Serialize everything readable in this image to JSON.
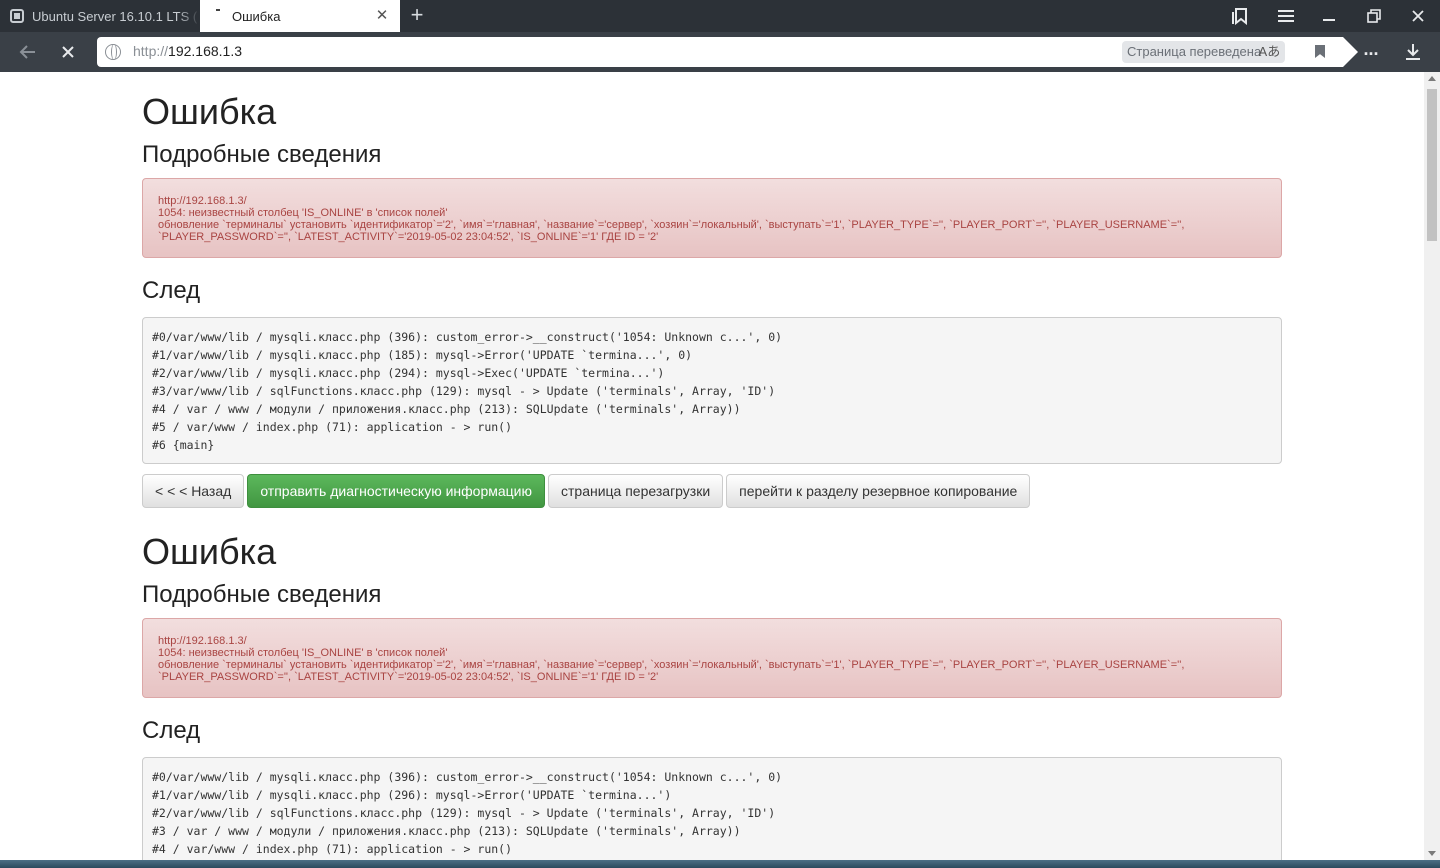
{
  "browser": {
    "tabs": [
      {
        "title": "Ubuntu Server 16.10.1 LTS (",
        "active": false
      },
      {
        "title": "Ошибка",
        "active": true
      }
    ],
    "url_protocol": "http://",
    "url_host": "192.168.1.3",
    "translated_label": "Страница переведена",
    "translate_glyph": "Aあ",
    "more_label": "..."
  },
  "page": {
    "blocks": [
      {
        "title": "Ошибка",
        "details_heading": "Подробные сведения",
        "alert_lines": [
          "http://192.168.1.3/",
          "1054: неизвестный столбец 'IS_ONLINE' в 'список полей'",
          "обновление `терминалы` установить `идентификатор`='2', `имя`='главная', `название`='сервер', `хозяин`='локальный', `выступать`='1', `PLAYER_TYPE`='', `PLAYER_PORT`='', `PLAYER_USERNAME`='',",
          "`PLAYER_PASSWORD`='', `LATEST_ACTIVITY`='2019-05-02 23:04:52', `IS_ONLINE`='1' ГДЕ ID = '2'"
        ],
        "trace_heading": "След",
        "trace_lines": [
          "#0/var/www/lib / mysqli.класс.php (396): custom_error->__construct('1054: Unknown c...', 0)",
          "#1/var/www/lib / mysqli.класс.php (185): mysql->Error('UPDATE `termina...', 0)",
          "#2/var/www/lib / mysqli.класс.php (294): mysql->Exec('UPDATE `termina...')",
          "#3/var/www/lib / sqlFunctions.класс.php (129): mysql - > Update ('terminals', Array, 'ID')",
          "#4 / var / www / модули / приложения.класс.php (213): SQLUpdate ('terminals', Array))",
          "#5 / var/www / index.php (71): application - > run()",
          "#6 {main}"
        ],
        "buttons": {
          "back": "< < < Назад",
          "send": "отправить диагностическую информацию",
          "reload": "страница перезагрузки",
          "backup": "перейти к разделу резервное копирование"
        }
      },
      {
        "title": "Ошибка",
        "details_heading": "Подробные сведения",
        "alert_lines": [
          "http://192.168.1.3/",
          "1054: неизвестный столбец 'IS_ONLINE' в 'список полей'",
          "обновление `терминалы` установить `идентификатор`='2', `имя`='главная', `название`='сервер', `хозяин`='локальный', `выступать`='1', `PLAYER_TYPE`='', `PLAYER_PORT`='', `PLAYER_USERNAME`='',",
          "`PLAYER_PASSWORD`='', `LATEST_ACTIVITY`='2019-05-02 23:04:52', `IS_ONLINE`='1' ГДЕ ID = '2'"
        ],
        "trace_heading": "След",
        "trace_lines": [
          "#0/var/www/lib / mysqli.класс.php (396): custom_error->__construct('1054: Unknown c...', 0)",
          "#1/var/www/lib / mysqli.класс.php (296): mysql->Error('UPDATE `termina...')",
          "#2/var/www/lib / sqlFunctions.класс.php (129): mysql - > Update ('terminals', Array, 'ID')",
          "#3 / var / www / модули / приложения.класс.php (213): SQLUpdate ('terminals', Array))",
          "#4 / var/www / index.php (71): application - > run()"
        ]
      }
    ]
  },
  "colors": {
    "tabbar_bg": "#2c3137",
    "navbar_bg": "#3a4047",
    "alert_text": "#a94442",
    "alert_bg": "#f2dede",
    "success_button": "#5cb85c"
  }
}
